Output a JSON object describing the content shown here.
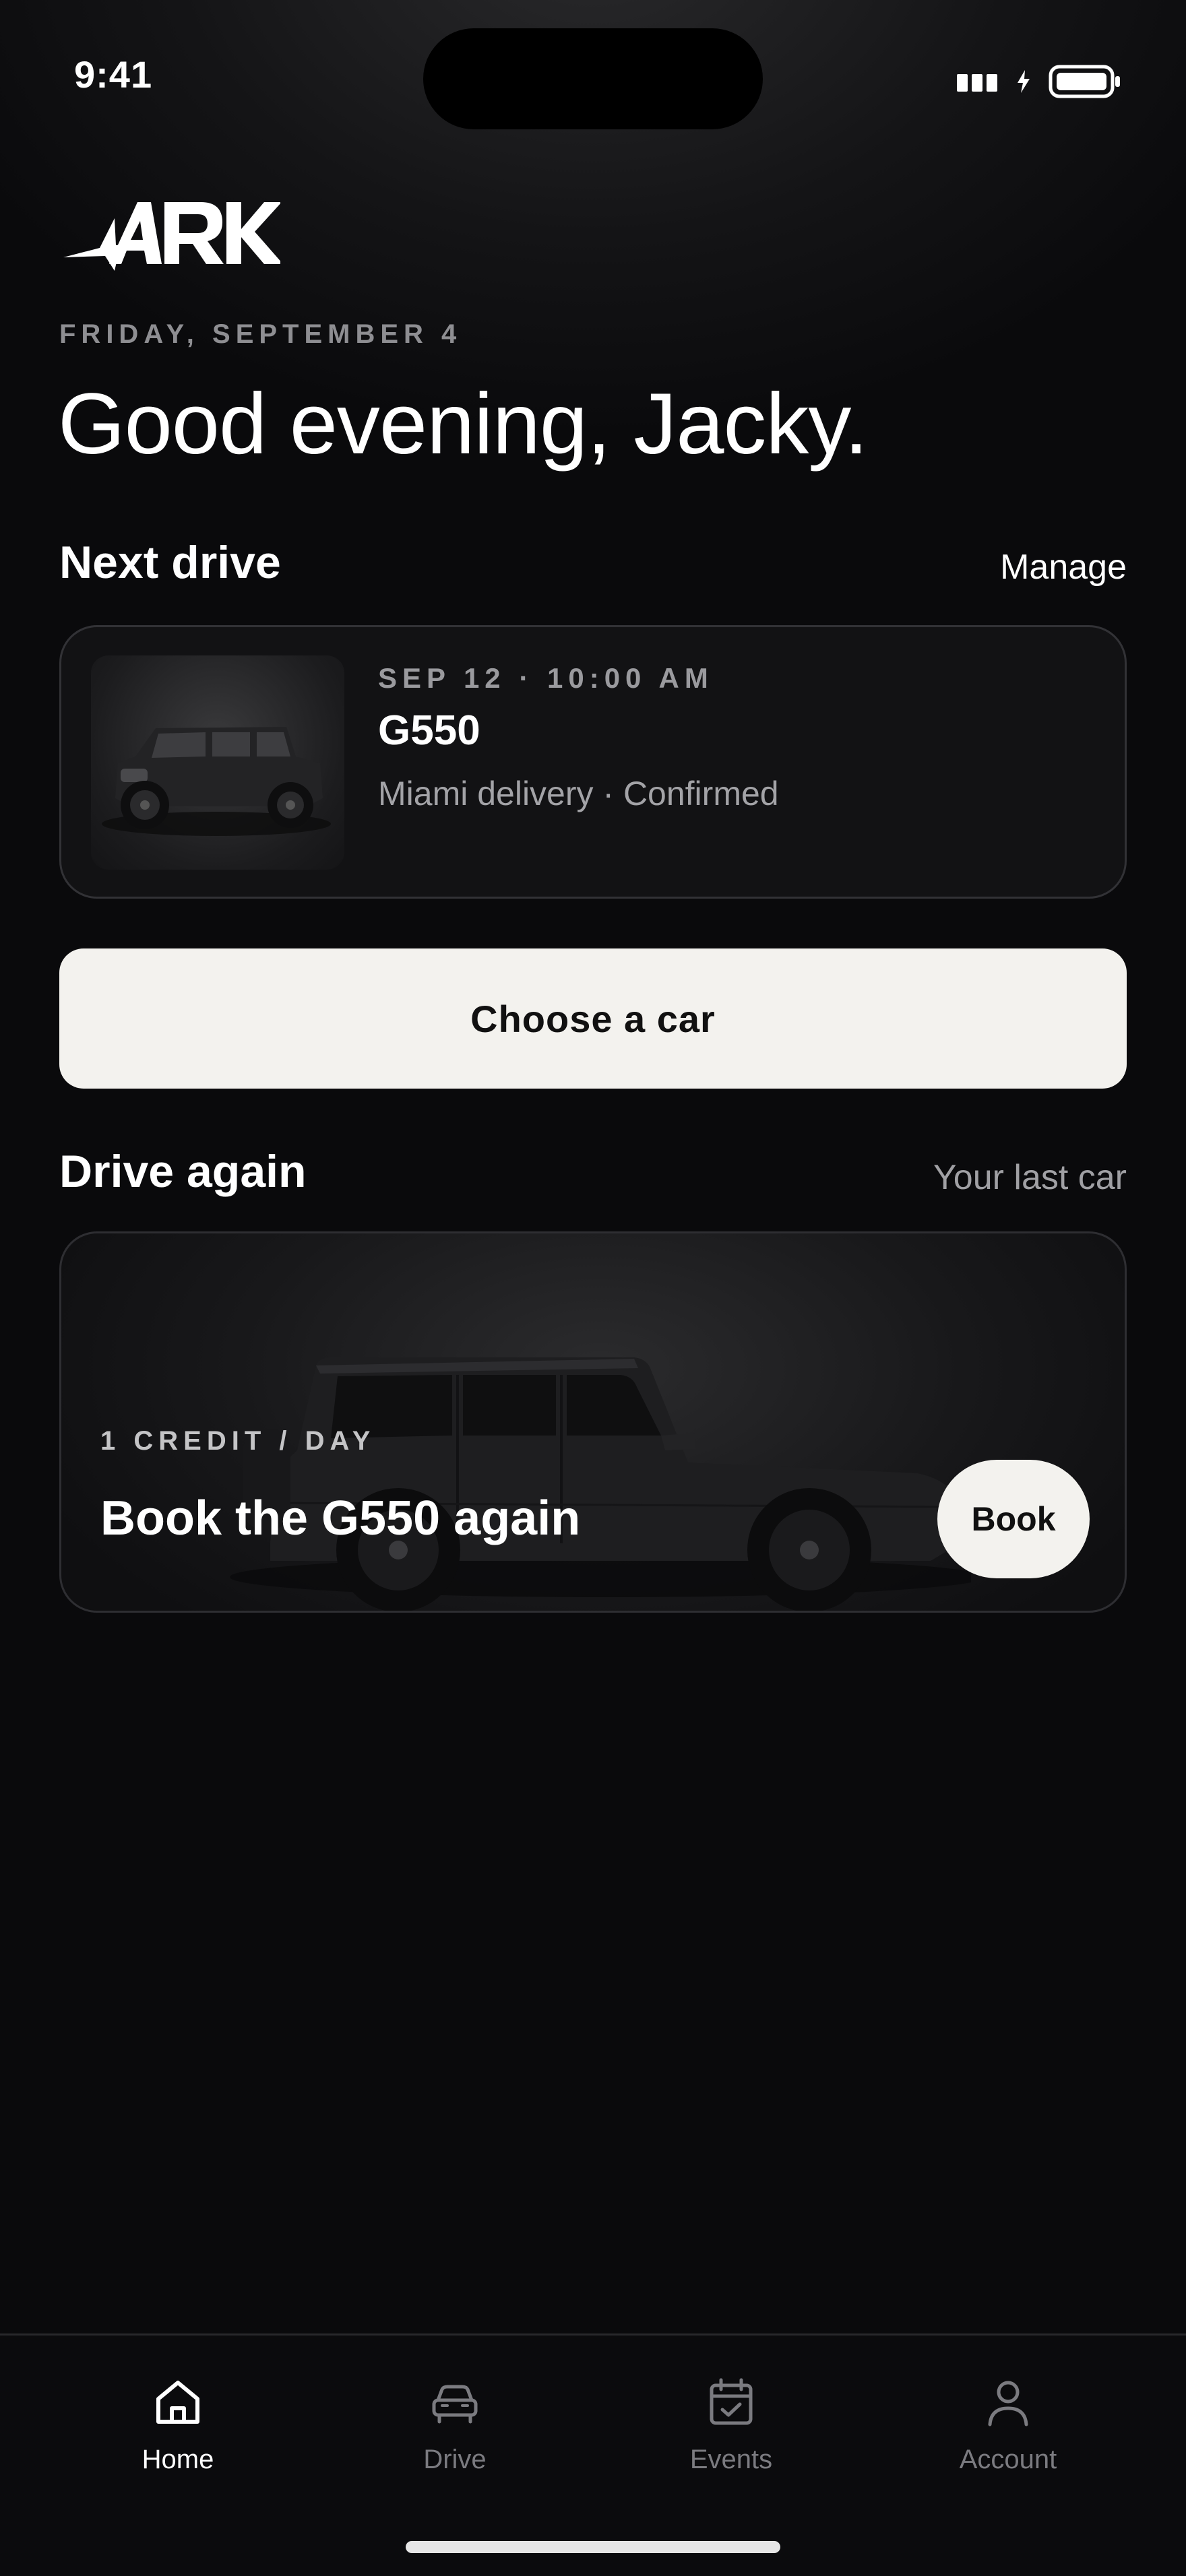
{
  "status_bar": {
    "time": "9:41"
  },
  "brand": {
    "logo_icon": "ark-logo"
  },
  "header": {
    "date": "FRIDAY, SEPTEMBER 4",
    "greeting": "Good evening, Jacky."
  },
  "next_drive": {
    "title": "Next drive",
    "manage_label": "Manage",
    "meta": "SEP 12 · 10:00 AM",
    "model": "G550",
    "status": "Miami delivery · Confirmed"
  },
  "choose_car": {
    "label": "Choose a car"
  },
  "drive_again": {
    "title": "Drive again",
    "subtitle": "Your last car",
    "price": "1 CREDIT / DAY",
    "headline": "Book the G550 again",
    "book_label": "Book"
  },
  "tab_bar": {
    "tabs": [
      {
        "label": "Home",
        "icon": "home-icon",
        "active": true
      },
      {
        "label": "Drive",
        "icon": "car-icon",
        "active": false
      },
      {
        "label": "Events",
        "icon": "calendar-check-icon",
        "active": false
      },
      {
        "label": "Account",
        "icon": "person-icon",
        "active": false
      }
    ]
  },
  "colors": {
    "background": "#0a0a0c",
    "button_light": "#f3f2ee",
    "muted_text": "#8e8e92",
    "card_border": "#323236"
  }
}
